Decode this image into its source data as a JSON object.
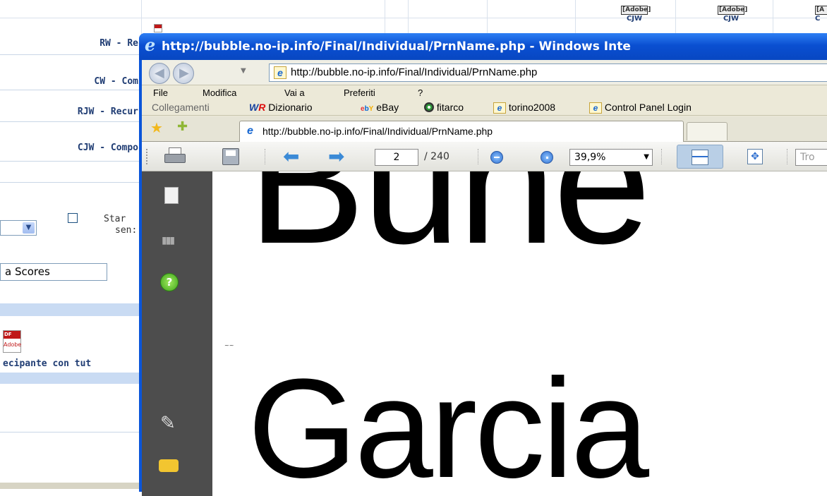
{
  "background": {
    "rows": [
      "RW - Re",
      "CW - Com",
      "RJW - Recur",
      "CJW - Compo"
    ],
    "header_cells": [
      {
        "top": "[Adobe]",
        "bottom": "CJW"
      },
      {
        "top": "[Adobe]",
        "bottom": "CJW"
      },
      {
        "top": "[A",
        "bottom": "C"
      }
    ],
    "checkbox_label_1": "Star",
    "checkbox_label_2": "sen:",
    "scores_field": "a Scores",
    "pdf_label": "ecipante con tut",
    "pdf_icon_text": "Adobe"
  },
  "window": {
    "title": "http://bubble.no-ip.info/Final/Individual/PrnName.php - Windows Inte",
    "address": "http://bubble.no-ip.info/Final/Individual/PrnName.php",
    "menu": [
      "File",
      "Modifica",
      "Vai a",
      "Preferiti",
      "?"
    ],
    "links_label": "Collegamenti",
    "links": [
      {
        "icon": "WR",
        "label": "Dizionario"
      },
      {
        "icon": "ebY",
        "label": "eBay"
      },
      {
        "icon": "fitarco-icon",
        "label": "fitarco"
      },
      {
        "icon": "ie-icon",
        "label": "torino2008"
      },
      {
        "icon": "ie-icon",
        "label": "Control Panel Login"
      }
    ],
    "tab_title": "http://bubble.no-ip.info/Final/Individual/PrnName.php"
  },
  "pdf": {
    "page_current": "2",
    "page_total": "/ 240",
    "zoom": "39,9%",
    "find_placeholder": "Tro",
    "text_line1": "Bune",
    "text_line2": "Garcia",
    "small_mark": "~~"
  },
  "colors": {
    "title_blue": "#0a4fd1",
    "bg_text": "#1f3c73",
    "pdf_side": "#4d4d4d"
  }
}
